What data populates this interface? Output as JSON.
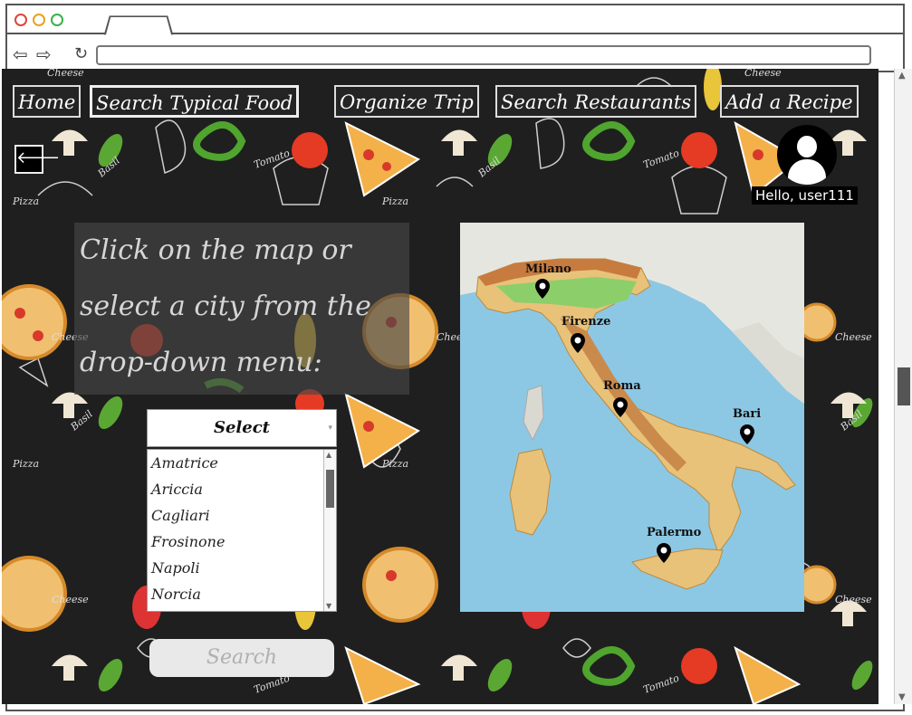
{
  "nav": {
    "home": "Home",
    "search_typical_food": "Search Typical Food",
    "organize_trip": "Organize Trip",
    "search_restaurants": "Search Restaurants",
    "add_recipe": "Add a Recipe"
  },
  "user": {
    "greeting": "Hello, user111"
  },
  "instructions": {
    "line1": "Click on the map or",
    "line2": "select a city from the",
    "line3": "drop-down menu:"
  },
  "select": {
    "label": "Select",
    "options": [
      "Amatrice",
      "Ariccia",
      "Cagliari",
      "Frosinone",
      "Napoli",
      "Norcia"
    ]
  },
  "search_button": "Search",
  "map": {
    "cities": [
      "Milano",
      "Firenze",
      "Roma",
      "Bari",
      "Palermo"
    ]
  },
  "icons": {
    "back": "arrow-left-icon",
    "user": "user-avatar-icon"
  }
}
